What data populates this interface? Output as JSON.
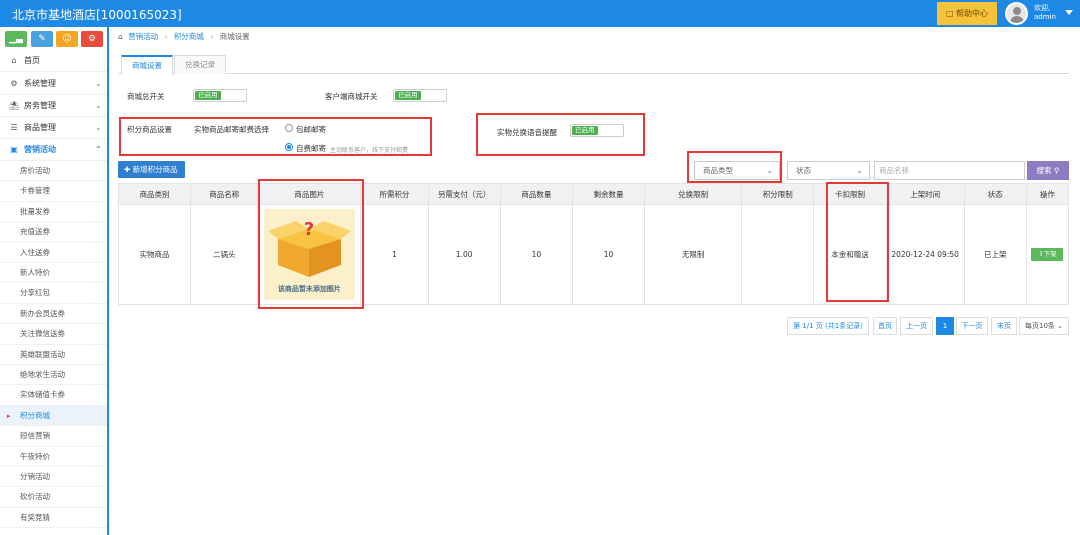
{
  "app": {
    "title": "北京市基地酒店[1000165023]",
    "help_label": "帮助中心",
    "welcome_label": "欢迎,",
    "user_name": "admin",
    "colors": {
      "brand": "#1e88e5",
      "help": "#f5c23a",
      "highlight": "#e53935"
    }
  },
  "quick_buttons": [
    {
      "icon": "bar-chart-icon",
      "glyph": "▁▃"
    },
    {
      "icon": "pencil-icon",
      "glyph": "✎"
    },
    {
      "icon": "group-icon",
      "glyph": "☺"
    },
    {
      "icon": "cogs-icon",
      "glyph": "⚙"
    }
  ],
  "sidebar": {
    "items": [
      {
        "label": "首页",
        "icon": "home-icon"
      },
      {
        "label": "系统管理",
        "icon": "gear-icon"
      },
      {
        "label": "房务管理",
        "icon": "bank-icon"
      },
      {
        "label": "商品管理",
        "icon": "database-icon"
      },
      {
        "label": "营销活动",
        "icon": "gift-icon"
      }
    ],
    "sub_items": [
      "房价活动",
      "卡券管理",
      "批量发券",
      "充值送券",
      "入住送券",
      "新人特价",
      "分享红包",
      "新办会员送券",
      "关注微信送券",
      "英雄联盟活动",
      "绝地求生活动",
      "实体储值卡券",
      "积分商城",
      "短信营销",
      "午夜特价",
      "分销活动",
      "砍价活动",
      "有奖竞猜"
    ],
    "current_sub": "积分商城"
  },
  "breadcrumb": {
    "items": [
      "营销活动",
      "积分商城",
      "商城设置"
    ]
  },
  "tabs": [
    "商城设置",
    "兑换记录"
  ],
  "settings": {
    "mall_switch_label": "商城总开关",
    "mall_switch_value": "已启用",
    "client_switch_label": "客户端商城开关",
    "client_switch_value": "已启用",
    "points_goods_label": "积分商品设置",
    "shipping_label": "实物商品邮寄邮费选择",
    "free_shipping_label": "包邮邮寄",
    "self_pay_label": "自费邮寄",
    "self_pay_hint": "主动联系客户，线下支付邮费",
    "voice_alert_label": "实物兑换语音提醒",
    "voice_alert_value": "已启用"
  },
  "toolbar": {
    "add_label": "新增积分商品",
    "type_select": "商品类型",
    "status_select": "状态",
    "name_placeholder": "商品名称",
    "search_label": "搜索"
  },
  "table": {
    "headers": [
      "商品类别",
      "商品名称",
      "商品图片",
      "所需积分",
      "另需支付（元）",
      "商品数量",
      "剩余数量",
      "兑换限制",
      "积分限制",
      "卡扣限制",
      "上架时间",
      "状态",
      "操作"
    ],
    "rows": [
      {
        "category": "实物商品",
        "name": "二锅头",
        "image_caption": "该商品暂未添加图片",
        "points": "1",
        "extra_pay": "1.00",
        "quantity": "10",
        "remaining": "10",
        "exchange_limit": "无限制",
        "points_limit": "",
        "card_limit": "本金和赠送",
        "listed_time": "2020-12-24 09:50",
        "status": "已上架",
        "action": "下架"
      }
    ]
  },
  "pagination": {
    "summary": "第 1/1 页 (共1条记录)",
    "first": "首页",
    "prev": "上一页",
    "current": "1",
    "next": "下一页",
    "last": "末页",
    "page_size": "每页10条"
  }
}
